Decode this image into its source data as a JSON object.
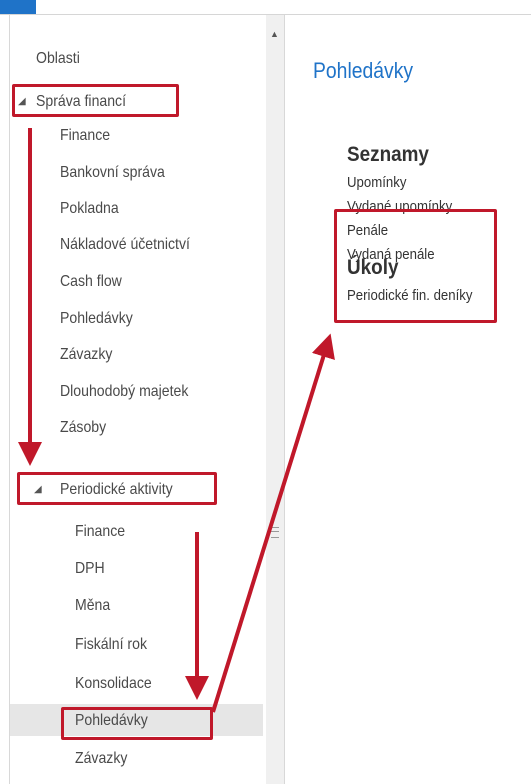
{
  "nav": {
    "items": [
      {
        "label": "Oblasti"
      },
      {
        "label": "Správa financí"
      },
      {
        "label": "Finance"
      },
      {
        "label": "Bankovní správa"
      },
      {
        "label": "Pokladna"
      },
      {
        "label": "Nákladové účetnictví"
      },
      {
        "label": "Cash flow"
      },
      {
        "label": "Pohledávky"
      },
      {
        "label": "Závazky"
      },
      {
        "label": "Dlouhodobý majetek"
      },
      {
        "label": "Zásoby"
      },
      {
        "label": "Periodické aktivity"
      },
      {
        "label": "Finance"
      },
      {
        "label": "DPH"
      },
      {
        "label": "Měna"
      },
      {
        "label": "Fiskální rok"
      },
      {
        "label": "Konsolidace"
      },
      {
        "label": "Pohledávky"
      },
      {
        "label": "Závazky"
      }
    ],
    "expanded_glyph": "◢"
  },
  "content": {
    "title": "Pohledávky",
    "sections": [
      {
        "heading": "Seznamy",
        "links": [
          "Upomínky",
          "Vydané upomínky",
          "Penále",
          "Vydaná penále"
        ]
      },
      {
        "heading": "Úkoly",
        "links": [
          "Periodické fin. deníky"
        ]
      }
    ]
  },
  "colors": {
    "accent": "#1f73c8",
    "annotation": "#c0182a",
    "selected": "#e6e6e6"
  }
}
